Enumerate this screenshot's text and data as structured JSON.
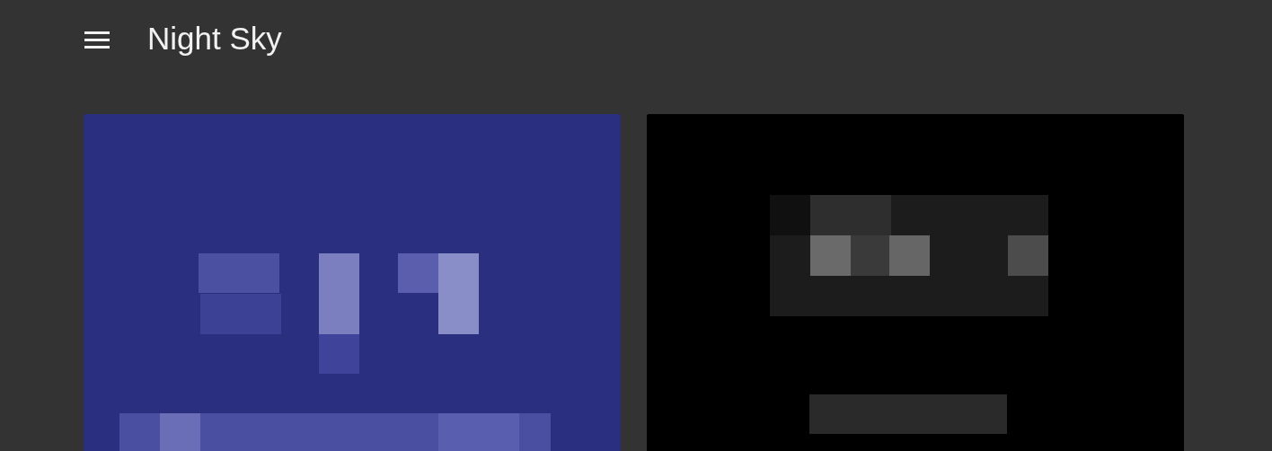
{
  "app_bar": {
    "title": "Night Sky"
  }
}
